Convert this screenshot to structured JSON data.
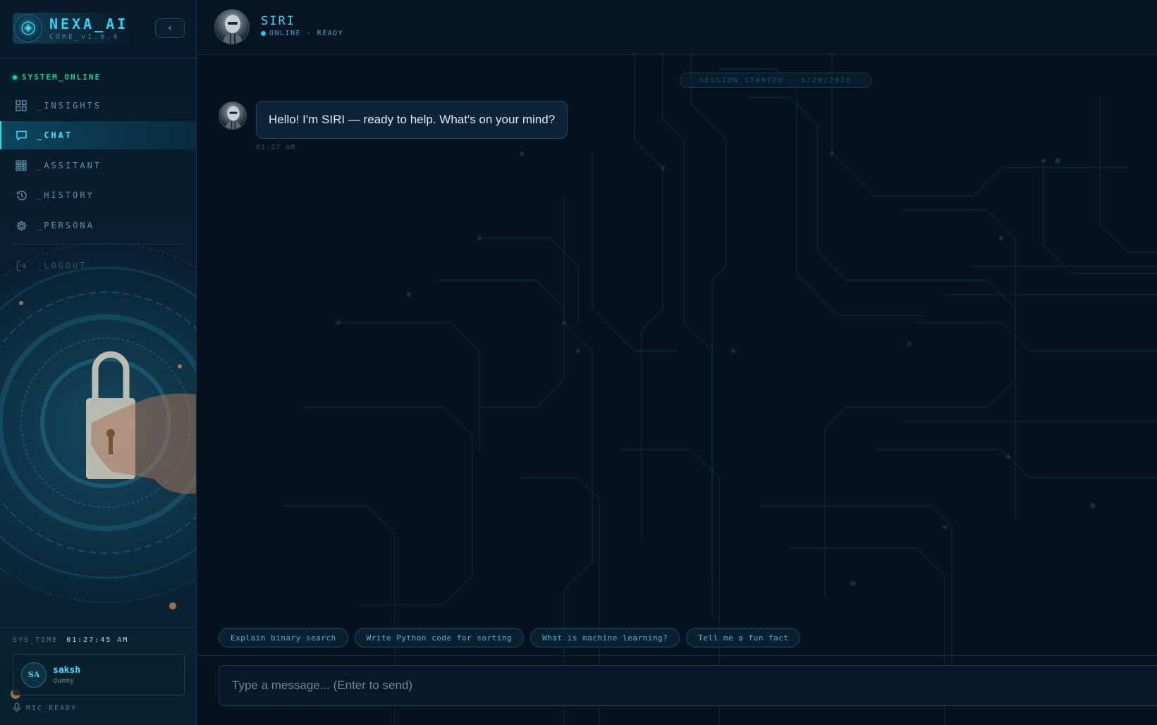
{
  "brand": {
    "name": "NEXA_AI",
    "version": "CORE_v1.0.4"
  },
  "sidebar": {
    "status": "SYSTEM_ONLINE",
    "items": [
      {
        "label": "_INSIGHTS",
        "icon": "grid-icon"
      },
      {
        "label": "_CHAT",
        "icon": "chat-icon",
        "active": true
      },
      {
        "label": "_ASSITANT",
        "icon": "apps-icon"
      },
      {
        "label": "_HISTORY",
        "icon": "history-icon"
      },
      {
        "label": "_PERSONA",
        "icon": "gear-icon"
      }
    ],
    "logout": "_LOGOUT",
    "sys_time_label": "SYS_TIME",
    "sys_time_value": "01:27:45 AM",
    "user": {
      "initials": "SA",
      "name": "saksh",
      "role": "dummy"
    },
    "mic_status": "MIC_READY"
  },
  "chat": {
    "bot_name": "SIRI",
    "bot_status": "ONLINE · READY",
    "session_label": "SESSION_STARTED · 5/20/2026",
    "messages": [
      {
        "from": "bot",
        "text": "Hello! I'm SIRI — ready to help. What's on your mind?",
        "time": "01:27 AM"
      }
    ],
    "suggestions": [
      "Explain binary search",
      "Write Python code for sorting",
      "What is machine learning?",
      "Tell me a fun fact"
    ],
    "composer_placeholder": "Type a message... (Enter to send)"
  },
  "colors": {
    "accent": "#35d2ee",
    "online": "#22d38d",
    "background": "#06121f"
  }
}
